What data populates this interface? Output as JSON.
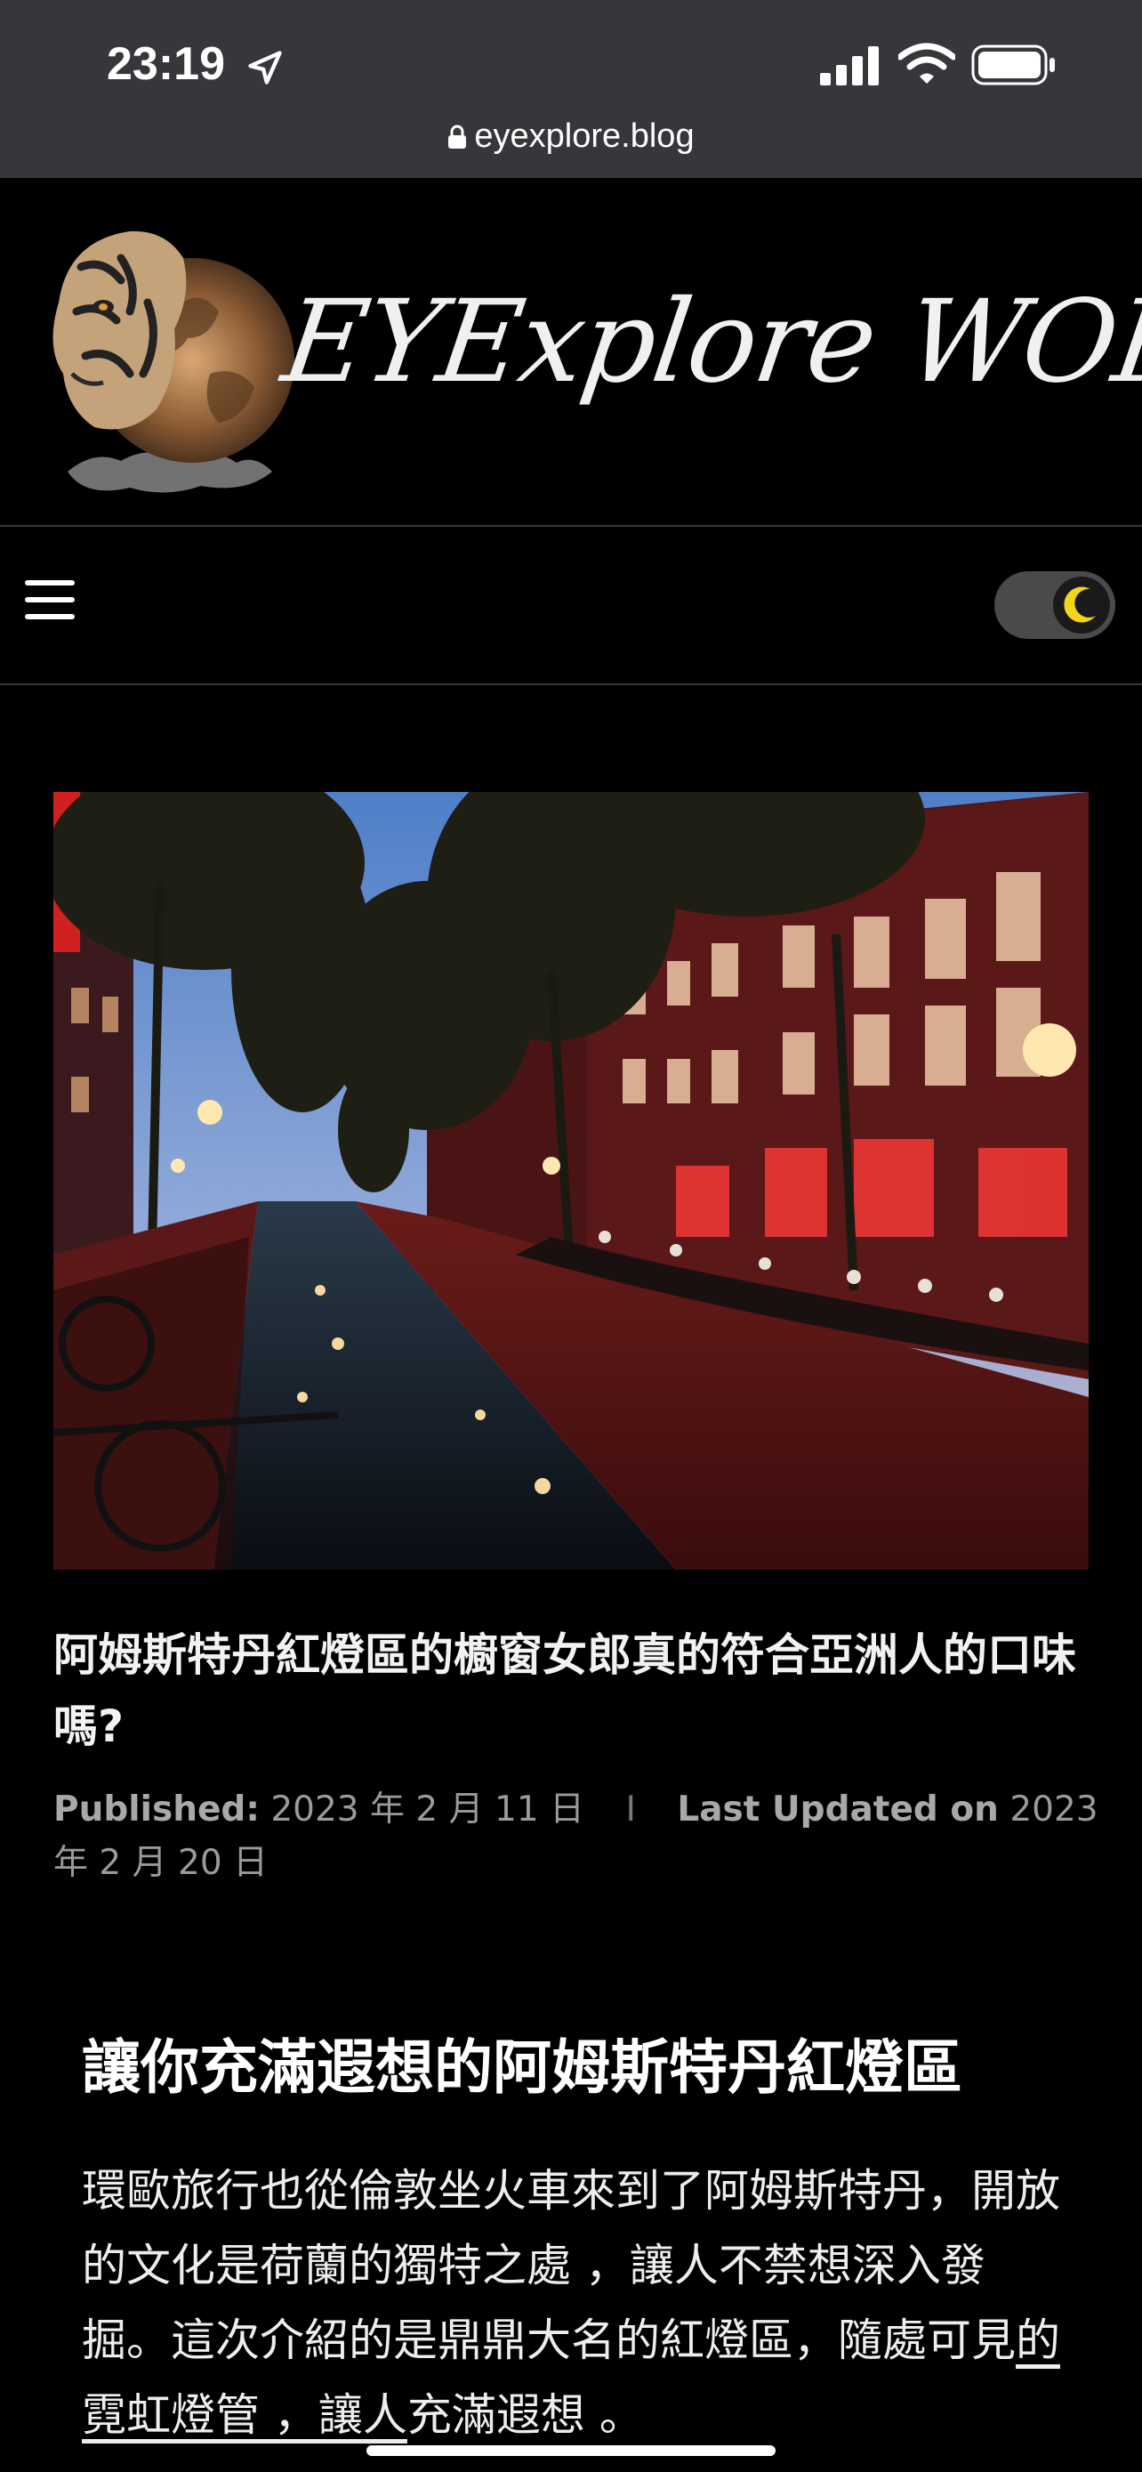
{
  "status_bar": {
    "time": "23:19",
    "url": "eyexplore.blog"
  },
  "header": {
    "site_title": "EYExplore WORLD"
  },
  "post": {
    "title": "阿姆斯特丹紅燈區的櫥窗女郎真的符合亞洲人的口味嗎?",
    "published_label": "Published:",
    "published_date": "2023 年 2 月 11 日",
    "separator": "I",
    "updated_label": "Last Updated on",
    "updated_date": "2023 年 2 月 20 日"
  },
  "article": {
    "heading": "讓你充滿遐想的阿姆斯特丹紅燈區",
    "paragraph_start": "環歐旅行也從倫敦坐火車來到了阿姆斯特丹，開放的文化是荷蘭的獨特之處 ，讓人不禁想深入發掘。這次介紹的是鼎鼎大名的紅燈區，隨處可見",
    "link_text": "的霓虹燈管 ，讓人",
    "paragraph_end": "充滿遐想 。"
  },
  "colors": {
    "status_bg": "#35373a",
    "page_bg": "#000000",
    "moon": "#f4d41c"
  }
}
